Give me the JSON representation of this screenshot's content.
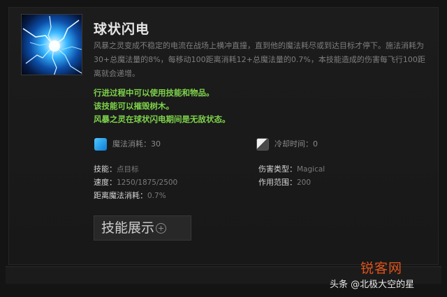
{
  "skill": {
    "name": "球状闪电",
    "icon": "ball-lightning-icon",
    "description": "风暴之灵变成不稳定的电流在战场上横冲直撞，直到他的魔法耗尽或到达目标才停下。施法消耗为30+总魔法量的8%，每移动100距离消耗12+总魔法量的0.7%，本技能造成的伤害每飞行100距离就会递增。",
    "notes": [
      "行进过程中可以使用技能和物品。",
      "该技能可以摧毁树木。",
      "风暴之灵在球状闪电期间是无敌状态。"
    ],
    "mana_cost": {
      "label": "魔法消耗：",
      "value": "30",
      "icon": "mana-icon",
      "color": "#29a3ec"
    },
    "cooldown": {
      "label": "冷却时间：",
      "value": "0",
      "icon": "cooldown-icon"
    },
    "stats": {
      "ability": {
        "label": "技能：",
        "value": "点目标"
      },
      "damage_type": {
        "label": "伤害类型：",
        "value": "Magical"
      },
      "speed": {
        "label": "速度：",
        "value": "1250/1875/2500"
      },
      "range": {
        "label": "作用范围：",
        "value": "200"
      },
      "distance_cost": {
        "label": "距离魔法消耗：",
        "value": "0.7%"
      }
    },
    "showcase_button": "技能展示"
  },
  "watermark": {
    "site": "锐客网",
    "author": "头条 @北极大空的星"
  },
  "colors": {
    "note_green": "#7ed34a",
    "title": "#e6e6e6",
    "background": "#141414"
  }
}
